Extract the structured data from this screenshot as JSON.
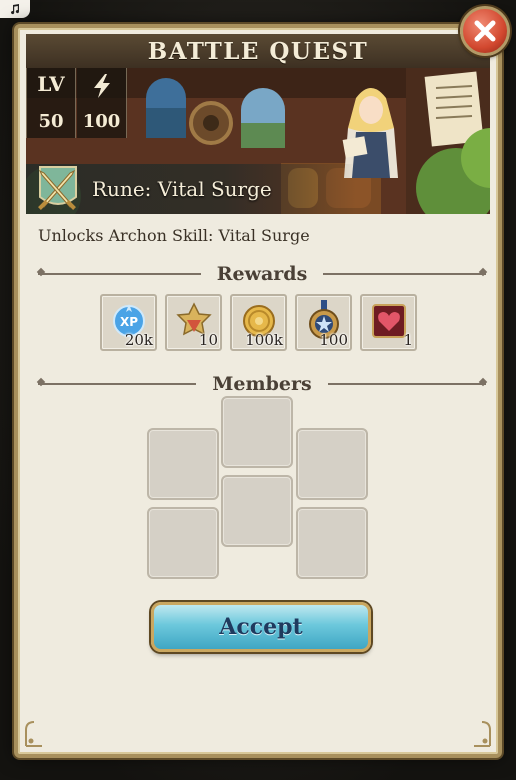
{
  "dialog": {
    "title": "BATTLE QUEST",
    "close_icon": "close-x-icon"
  },
  "quest": {
    "level_label": "LV",
    "level_value": "50",
    "energy_icon": "lightning-icon",
    "energy_value": "100",
    "rune_icon": "crossed-swords-icon",
    "rune_name": "Rune: Vital Surge",
    "unlock_text": "Unlocks Archon Skill: Vital Surge"
  },
  "rewards": {
    "heading": "Rewards",
    "items": [
      {
        "icon": "xp-orb-icon",
        "qty": "20k"
      },
      {
        "icon": "rank-badge-icon",
        "qty": "10"
      },
      {
        "icon": "gold-coin-icon",
        "qty": "100k"
      },
      {
        "icon": "star-medal-icon",
        "qty": "100"
      },
      {
        "icon": "heart-card-icon",
        "qty": "1"
      }
    ]
  },
  "members": {
    "heading": "Members",
    "slot_count": 6
  },
  "actions": {
    "accept_label": "Accept"
  },
  "colors": {
    "panel_bg": "#efebdf",
    "frame_gold": "#a8905d",
    "close_red": "#d2482f",
    "accept_cyan": "#6cc8dc"
  }
}
